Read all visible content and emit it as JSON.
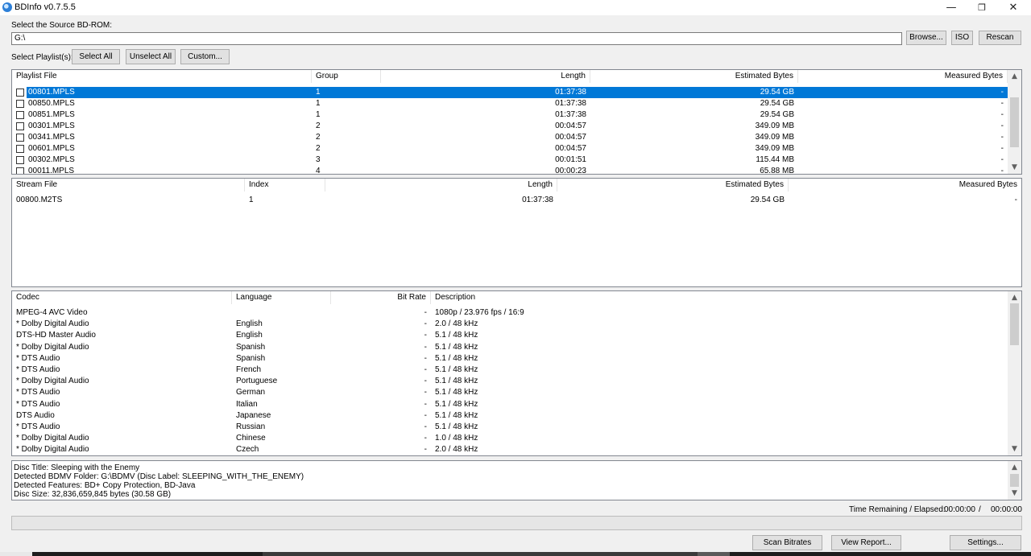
{
  "window": {
    "title": "BDInfo v0.7.5.5"
  },
  "source": {
    "label": "Select the Source BD-ROM:",
    "path": "G:\\",
    "browse": "Browse...",
    "iso": "ISO",
    "rescan": "Rescan"
  },
  "playlist_controls": {
    "label": "Select Playlist(s):",
    "select_all": "Select All",
    "unselect_all": "Unselect All",
    "custom": "Custom..."
  },
  "playlists": {
    "headers": [
      "Playlist File",
      "Group",
      "Length",
      "Estimated Bytes",
      "Measured Bytes"
    ],
    "rows": [
      {
        "file": "00801.MPLS",
        "group": "1",
        "length": "01:37:38",
        "est": "29.54 GB",
        "measured": "-",
        "selected": true
      },
      {
        "file": "00850.MPLS",
        "group": "1",
        "length": "01:37:38",
        "est": "29.54 GB",
        "measured": "-"
      },
      {
        "file": "00851.MPLS",
        "group": "1",
        "length": "01:37:38",
        "est": "29.54 GB",
        "measured": "-"
      },
      {
        "file": "00301.MPLS",
        "group": "2",
        "length": "00:04:57",
        "est": "349.09 MB",
        "measured": "-"
      },
      {
        "file": "00341.MPLS",
        "group": "2",
        "length": "00:04:57",
        "est": "349.09 MB",
        "measured": "-"
      },
      {
        "file": "00601.MPLS",
        "group": "2",
        "length": "00:04:57",
        "est": "349.09 MB",
        "measured": "-"
      },
      {
        "file": "00302.MPLS",
        "group": "3",
        "length": "00:01:51",
        "est": "115.44 MB",
        "measured": "-"
      },
      {
        "file": "00011.MPLS",
        "group": "4",
        "length": "00:00:23",
        "est": "65.88 MB",
        "measured": "-"
      }
    ]
  },
  "streams": {
    "headers": [
      "Stream File",
      "Index",
      "Length",
      "Estimated Bytes",
      "Measured Bytes"
    ],
    "rows": [
      {
        "file": "00800.M2TS",
        "index": "1",
        "length": "01:37:38",
        "est": "29.54 GB",
        "measured": "-"
      }
    ]
  },
  "codecs": {
    "headers": [
      "Codec",
      "Language",
      "Bit Rate",
      "Description"
    ],
    "rows": [
      {
        "codec": "MPEG-4 AVC Video",
        "language": "",
        "bitrate": "-",
        "desc": "1080p / 23.976 fps / 16:9"
      },
      {
        "codec": "* Dolby Digital Audio",
        "language": "English",
        "bitrate": "-",
        "desc": "2.0 / 48 kHz"
      },
      {
        "codec": "DTS-HD Master Audio",
        "language": "English",
        "bitrate": "-",
        "desc": "5.1 / 48 kHz"
      },
      {
        "codec": "* Dolby Digital Audio",
        "language": "Spanish",
        "bitrate": "-",
        "desc": "5.1 / 48 kHz"
      },
      {
        "codec": "* DTS Audio",
        "language": "Spanish",
        "bitrate": "-",
        "desc": "5.1 / 48 kHz"
      },
      {
        "codec": "* DTS Audio",
        "language": "French",
        "bitrate": "-",
        "desc": "5.1 / 48 kHz"
      },
      {
        "codec": "* Dolby Digital Audio",
        "language": "Portuguese",
        "bitrate": "-",
        "desc": "5.1 / 48 kHz"
      },
      {
        "codec": "* DTS Audio",
        "language": "German",
        "bitrate": "-",
        "desc": "5.1 / 48 kHz"
      },
      {
        "codec": "* DTS Audio",
        "language": "Italian",
        "bitrate": "-",
        "desc": "5.1 / 48 kHz"
      },
      {
        "codec": "DTS Audio",
        "language": "Japanese",
        "bitrate": "-",
        "desc": "5.1 / 48 kHz"
      },
      {
        "codec": "* DTS Audio",
        "language": "Russian",
        "bitrate": "-",
        "desc": "5.1 / 48 kHz"
      },
      {
        "codec": "* Dolby Digital Audio",
        "language": "Chinese",
        "bitrate": "-",
        "desc": "1.0 / 48 kHz"
      },
      {
        "codec": "* Dolby Digital Audio",
        "language": "Czech",
        "bitrate": "-",
        "desc": "2.0 / 48 kHz"
      }
    ]
  },
  "summary": [
    "Disc Title: Sleeping with the Enemy",
    "Detected BDMV Folder: G:\\BDMV (Disc Label: SLEEPING_WITH_THE_ENEMY)",
    "Detected Features: BD+ Copy Protection, BD-Java",
    "Disc Size: 32,836,659,845 bytes (30.58 GB)"
  ],
  "time": {
    "label": "Time Remaining / Elapsed:",
    "remaining": "00:00:00",
    "separator": "/",
    "elapsed": "00:00:00"
  },
  "progress": {
    "value": 0
  },
  "buttons": {
    "scan_bitrates": "Scan Bitrates",
    "view_report": "View Report...",
    "settings": "Settings..."
  },
  "colors": {
    "selection": "#0078d7",
    "window_bg": "#f0f0f0"
  },
  "icons": {
    "minimize": "minimize-icon",
    "maximize": "restore-icon",
    "close": "close-icon"
  }
}
